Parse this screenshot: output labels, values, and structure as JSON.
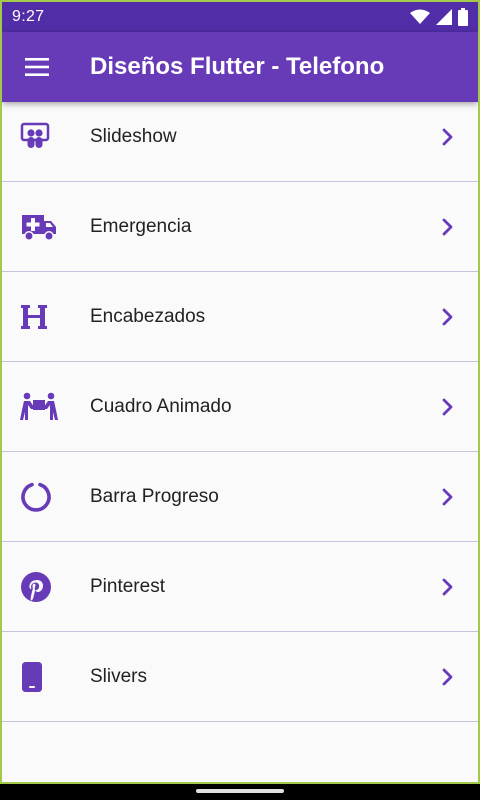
{
  "status": {
    "time": "9:27"
  },
  "app_bar": {
    "title": "Diseños Flutter - Telefono",
    "menu_icon": "menu-icon"
  },
  "colors": {
    "primary": "#673ab7",
    "primary_dark": "#512da8",
    "divider": "#c9c2de"
  },
  "items": [
    {
      "label": "Slideshow",
      "icon": "slideshare-icon"
    },
    {
      "label": "Emergencia",
      "icon": "ambulance-icon"
    },
    {
      "label": "Encabezados",
      "icon": "heading-icon"
    },
    {
      "label": "Cuadro Animado",
      "icon": "people-carry-icon"
    },
    {
      "label": "Barra Progreso",
      "icon": "circle-notch-icon"
    },
    {
      "label": "Pinterest",
      "icon": "pinterest-icon"
    },
    {
      "label": "Slivers",
      "icon": "mobile-icon"
    }
  ]
}
